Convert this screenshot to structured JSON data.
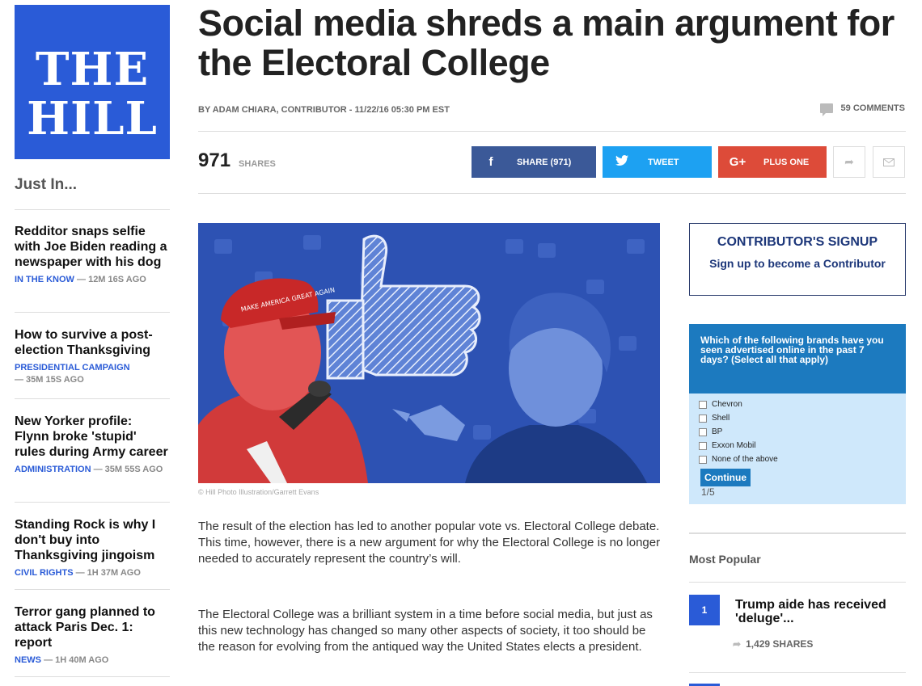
{
  "logo": {
    "line1": "THE",
    "line2": "HILL"
  },
  "sidebar": {
    "title": "Just In...",
    "items": [
      {
        "headline": "Redditor snaps selfie with Joe Biden reading a newspaper with his dog",
        "category": "IN THE KNOW",
        "time": "— 12M 16S AGO"
      },
      {
        "headline": "How to survive a post-election Thanksgiving",
        "category": "PRESIDENTIAL CAMPAIGN",
        "time": "— 35M 15S AGO"
      },
      {
        "headline": "New Yorker profile: Flynn broke 'stupid' rules during Army career",
        "category": "ADMINISTRATION",
        "time": "— 35M 55S AGO"
      },
      {
        "headline": "Standing Rock is why I don't buy into Thanksgiving jingoism",
        "category": "CIVIL RIGHTS",
        "time": "— 1H 37M AGO"
      },
      {
        "headline": "Terror gang planned to attack Paris Dec. 1: report",
        "category": "NEWS",
        "time": "— 1H 40M AGO"
      }
    ]
  },
  "article": {
    "headline": "Social media shreds a main argument for the Electoral College",
    "byline": "BY ADAM CHIARA, CONTRIBUTOR - 11/22/16 05:30 PM EST",
    "comments": "59 COMMENTS",
    "share_count": "971",
    "share_count_label": "SHARES",
    "caption": "© Hill Photo Illustration/Garrett Evans",
    "paragraphs": [
      "The result of the election has led to another popular vote vs. Electoral College debate. This time, however, there is a new argument for why the Electoral College is no longer needed to accurately represent the country’s will.",
      "The Electoral College was a brilliant system in a time before social media, but just as this new technology has changed so many other aspects of society, it too should be the reason for evolving from the antiqued way the United States elects a president."
    ],
    "photo_hat_text": "MAKE AMERICA GREAT AGAIN"
  },
  "share_buttons": {
    "facebook": {
      "icon": "f",
      "label": "SHARE (971)",
      "color": "#3b5998"
    },
    "twitter": {
      "label": "TWEET",
      "color": "#1da1f2"
    },
    "google": {
      "icon": "G+",
      "label": "PLUS ONE",
      "color": "#dd4b39"
    }
  },
  "signup": {
    "title": "CONTRIBUTOR'S SIGNUP",
    "link": "Sign up to become a Contributor"
  },
  "poll": {
    "question": "Which of the following brands have you seen advertised online in the past 7 days? (Select all that apply)",
    "options": [
      "Chevron",
      "Shell",
      "BP",
      "Exxon Mobil",
      "None of the above"
    ],
    "button": "Continue",
    "page": "1/5"
  },
  "popular": {
    "title": "Most Popular",
    "items": [
      {
        "rank": "1",
        "headline": "Trump aide has received 'deluge'...",
        "shares": "1,429 SHARES"
      }
    ]
  },
  "colors": {
    "brand": "#2a5bd7",
    "poll_header": "#1c7abf",
    "poll_bg": "#cfe8fb"
  }
}
